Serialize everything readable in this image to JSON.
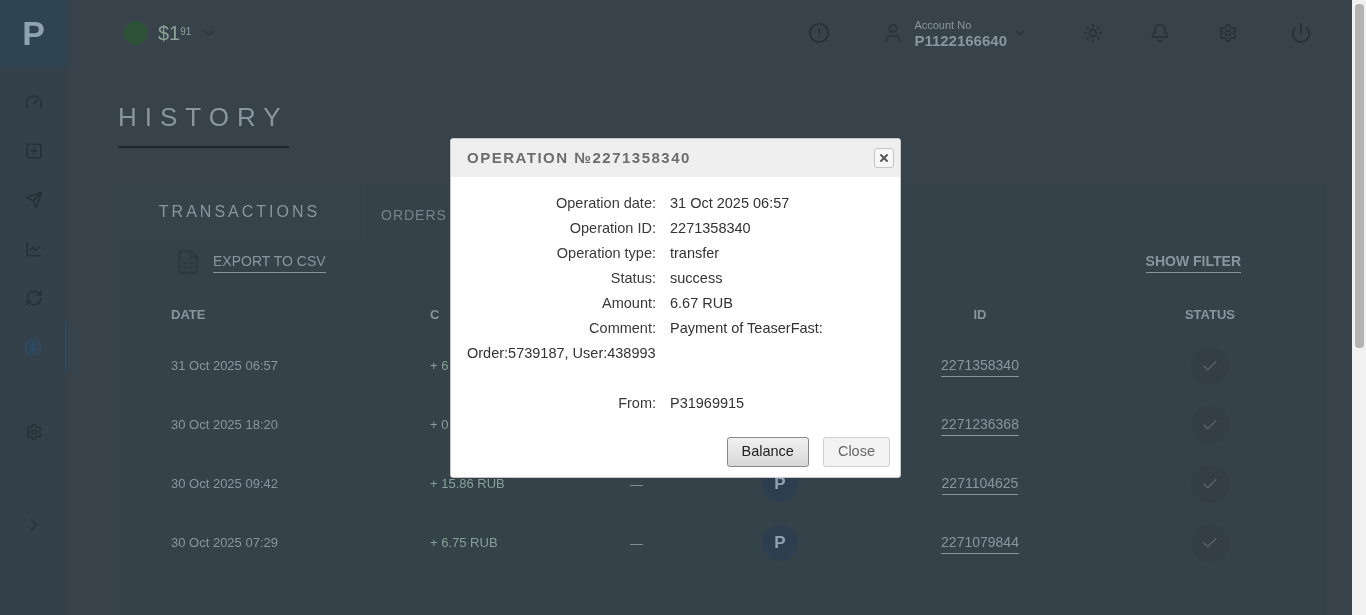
{
  "sidebar": {
    "logo": "P",
    "items": [
      {
        "selected": false
      },
      {
        "selected": false
      },
      {
        "selected": false
      },
      {
        "selected": false
      },
      {
        "selected": false
      },
      {
        "selected": true
      },
      {
        "selected": false
      }
    ]
  },
  "header": {
    "balance": "$1",
    "balance_cents": "91",
    "account_label": "Account No",
    "account": "P1122166640"
  },
  "page": {
    "title": "HISTORY",
    "tabs": [
      {
        "label": "TRANSACTIONS",
        "selected": true
      },
      {
        "label": "ORDERS",
        "selected": false
      }
    ],
    "export": "EXPORT TO CSV",
    "filter": "SHOW FILTER"
  },
  "table": {
    "columns": [
      {
        "label": "DATE"
      },
      {
        "label": "C"
      },
      {},
      {},
      {
        "label": "ID"
      },
      {
        "label": "STATUS"
      }
    ],
    "rows": [
      {
        "date": "31 Oct 2025 06:57",
        "amount": "+ 6",
        "id": "2271358340",
        "success": true
      },
      {
        "date": "30 Oct 2025 18:20",
        "amount": "+ 0",
        "id": "2271236368",
        "success": true
      },
      {
        "date": "30 Oct 2025 09:42",
        "amount": "+ 15.86 RUB",
        "comment": "—",
        "avatar": "P",
        "id": "2271104625",
        "success": true
      },
      {
        "date": "30 Oct 2025 07:29",
        "amount": "+ 6.75 RUB",
        "comment": "—",
        "avatar": "P",
        "id": "2271079844",
        "success": true
      }
    ]
  },
  "dialog": {
    "title": "OPERATION №2271358340",
    "fields": [
      {
        "label": "Operation date:",
        "value": "31 Oct 2025 06:57"
      },
      {
        "label": "Operation ID:",
        "value": "2271358340"
      },
      {
        "label": "Operation type:",
        "value": "transfer"
      },
      {
        "label": "Status:",
        "value": "success"
      },
      {
        "label": "Amount:",
        "value": "6.67 RUB"
      },
      {
        "label": "Comment:",
        "value": "Payment of TeaserFast:",
        "value_line_2": "Order:5739187, User:438993"
      },
      {
        "label": "From:",
        "value": "P31969915"
      }
    ],
    "buttons": [
      {
        "label": "Balance",
        "kind": "primary"
      },
      {
        "label": "Close",
        "kind": "secondary"
      }
    ]
  }
}
